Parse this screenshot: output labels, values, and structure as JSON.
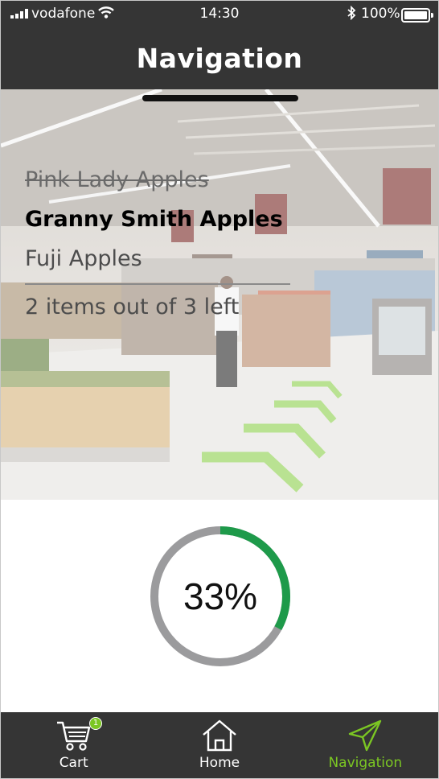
{
  "status_bar": {
    "carrier": "vodafone",
    "time": "14:30",
    "battery": "100%"
  },
  "header": {
    "title": "Navigation"
  },
  "shopping_list": {
    "items": [
      {
        "label": "Pink Lady Apples",
        "state": "done"
      },
      {
        "label": "Granny Smith Apples",
        "state": "active"
      },
      {
        "label": "Fuji Apples",
        "state": "pending"
      }
    ],
    "summary": "2 items out of 3 left"
  },
  "progress": {
    "label": "33%",
    "value": 0.33,
    "track_color": "#9b9b9d",
    "fill_color": "#1e9a4a"
  },
  "tabbar": {
    "tabs": [
      {
        "label": "Cart",
        "icon": "cart-icon",
        "badge": "1"
      },
      {
        "label": "Home",
        "icon": "home-icon"
      },
      {
        "label": "Navigation",
        "icon": "navigation-arrow-icon",
        "active": true
      }
    ],
    "active_color": "#7bc623"
  },
  "colors": {
    "bar_background": "#353535",
    "guide_arrows": "#8fd14f"
  }
}
